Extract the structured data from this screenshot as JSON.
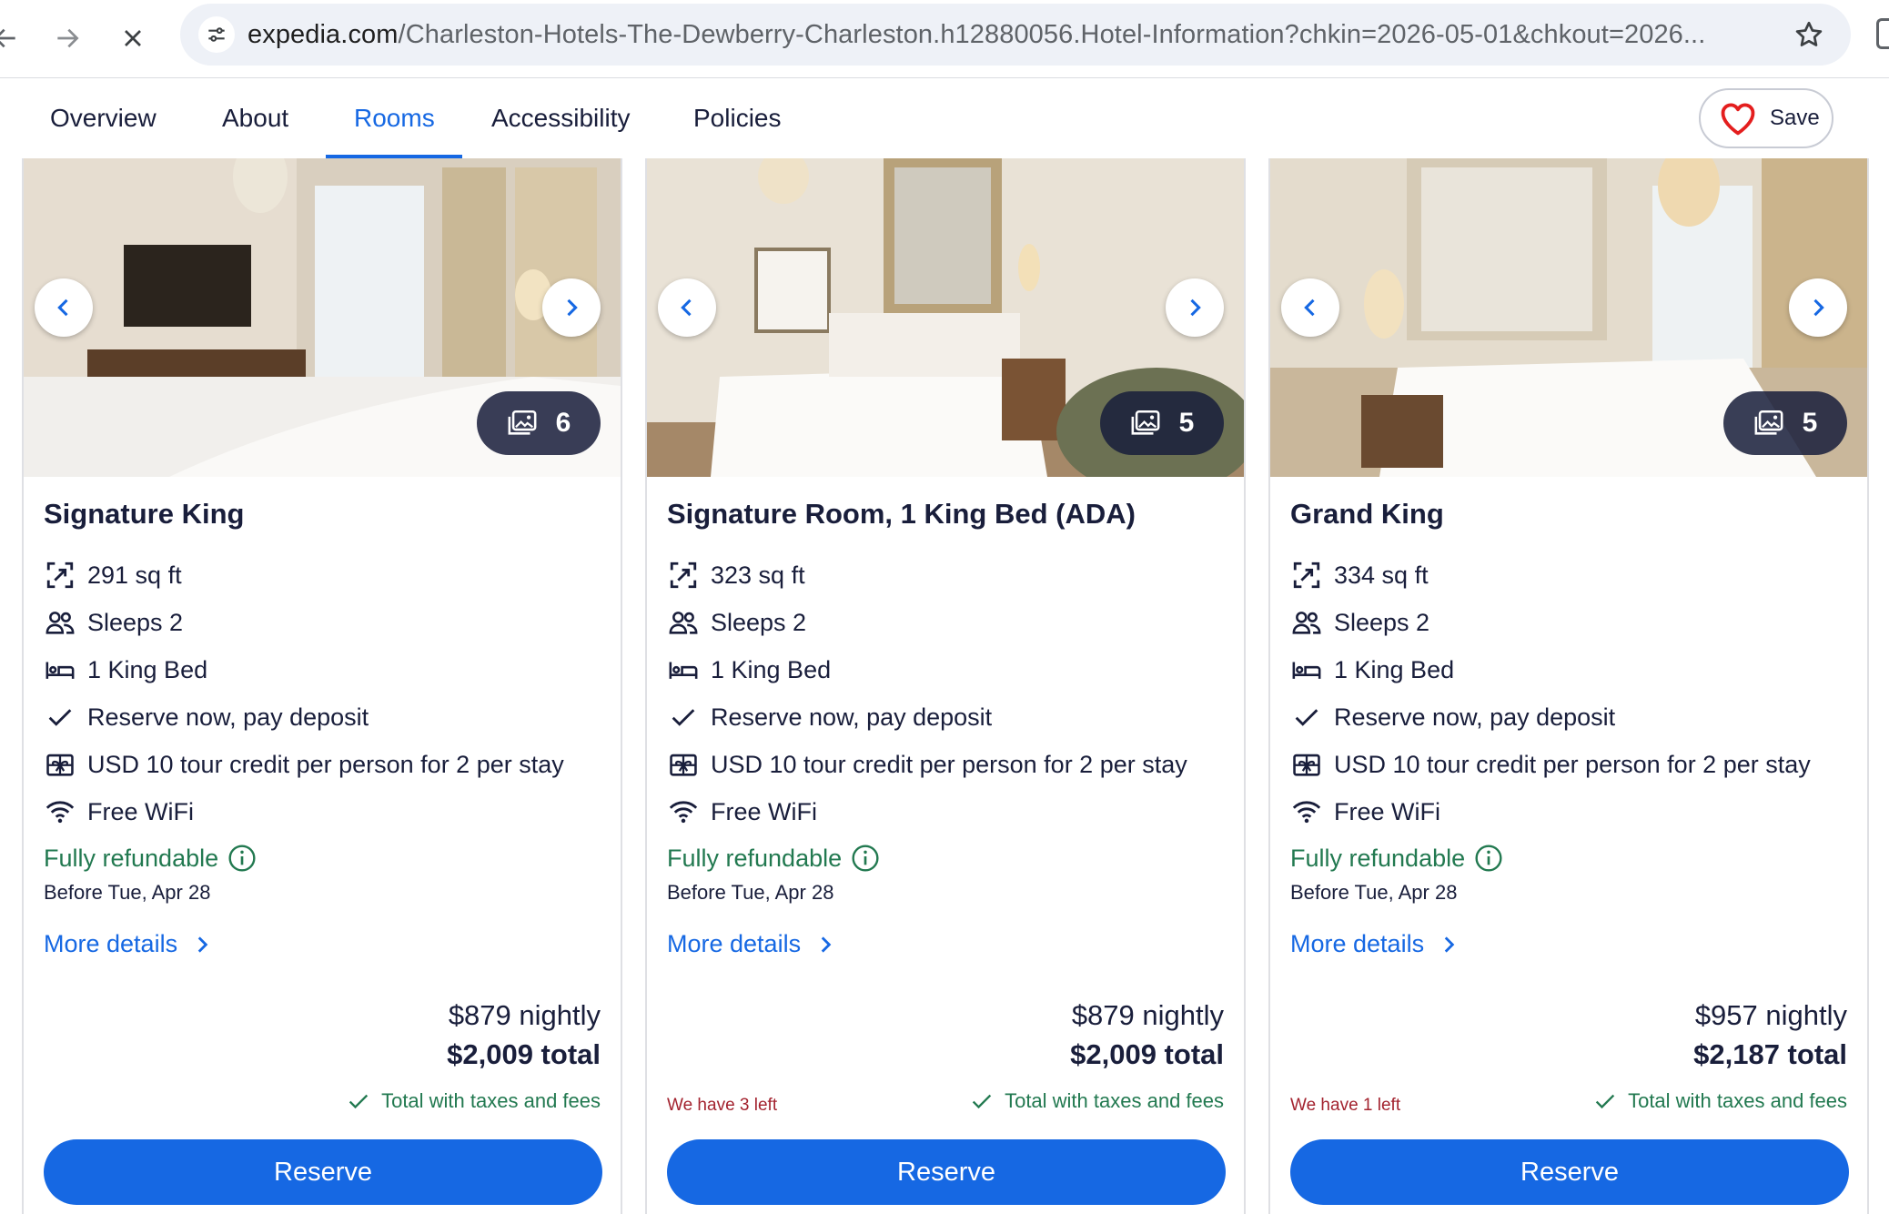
{
  "browser": {
    "url_host": "expedia.com",
    "url_path": "/Charleston-Hotels-The-Dewberry-Charleston.h12880056.Hotel-Information?chkin=2026-05-01&chkout=2026..."
  },
  "tabs": [
    {
      "label": "Overview"
    },
    {
      "label": "About"
    },
    {
      "label": "Rooms",
      "active": true
    },
    {
      "label": "Accessibility"
    },
    {
      "label": "Policies"
    }
  ],
  "save": {
    "label": "Save"
  },
  "common": {
    "reserve_label": "Reserve",
    "more_details": "More details",
    "fully_refundable": "Fully refundable",
    "taxes_note": "Total with taxes and fees",
    "features": [
      "Reserve now, pay deposit",
      "USD 10 tour credit per person for 2 per stay",
      "Free WiFi"
    ]
  },
  "rooms": [
    {
      "name": "Signature King",
      "photo_count": "6",
      "area": "291 sq ft",
      "sleeps": "Sleeps 2",
      "bed": "1 King Bed",
      "refund_deadline": "Before Tue, Apr 28",
      "nightly": "$879 nightly",
      "total": "$2,009 total",
      "scarcity": ""
    },
    {
      "name": "Signature Room, 1 King Bed (ADA)",
      "photo_count": "5",
      "area": "323 sq ft",
      "sleeps": "Sleeps 2",
      "bed": "1 King Bed",
      "refund_deadline": "Before Tue, Apr 28",
      "nightly": "$879 nightly",
      "total": "$2,009 total",
      "scarcity": "We have 3 left"
    },
    {
      "name": "Grand King",
      "photo_count": "5",
      "area": "334 sq ft",
      "sleeps": "Sleeps 2",
      "bed": "1 King Bed",
      "refund_deadline": "Before Tue, Apr 28",
      "nightly": "$957 nightly",
      "total": "$2,187 total",
      "scarcity": "We have 1 left"
    }
  ],
  "colors": {
    "accent": "#1668e3",
    "text": "#191e3b",
    "refund_green": "#227950",
    "scarcity_red": "#a3232f",
    "heart": "#e41e1e"
  },
  "icons": [
    "back-arrow-icon",
    "forward-arrow-icon",
    "stop-loading-icon",
    "site-settings-icon",
    "bookmark-star-icon",
    "heart-icon",
    "chevron-left-icon",
    "chevron-right-icon",
    "gallery-icon",
    "expand-area-icon",
    "people-icon",
    "bed-icon",
    "checkmark-icon",
    "gift-icon",
    "wifi-icon",
    "info-icon"
  ]
}
